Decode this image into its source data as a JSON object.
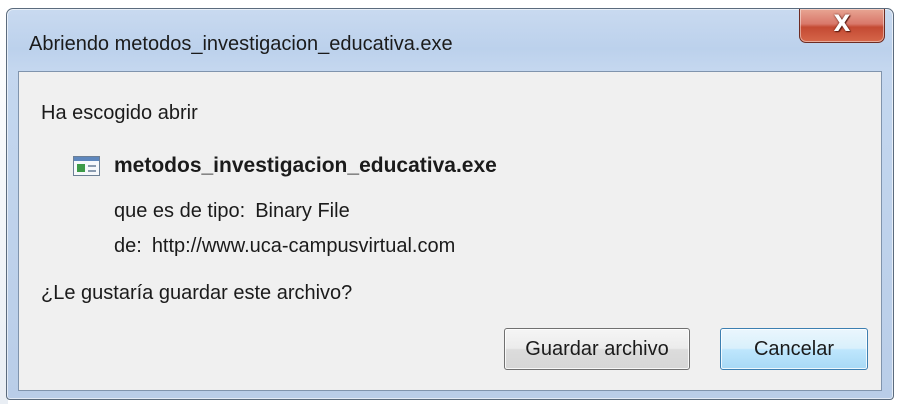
{
  "window": {
    "title": "Abriendo metodos_investigacion_educativa.exe",
    "close_glyph": "X",
    "close_icon": "close-icon"
  },
  "body": {
    "intro": "Ha escogido abrir",
    "file_icon": "executable-file-icon",
    "file_name": "metodos_investigacion_educativa.exe",
    "type_label": "que es de tipo:",
    "type_value": "Binary File",
    "from_label": "de:",
    "from_value": "http://www.uca-campusvirtual.com",
    "question": "¿Le gustaría guardar este archivo?"
  },
  "buttons": {
    "save_label": "Guardar archivo",
    "cancel_label": "Cancelar"
  },
  "colors": {
    "close_button": "#c44a33",
    "frame": "#bcd1ec",
    "content_bg": "#f0f0f0",
    "focused_button": "#3c7fb1"
  }
}
